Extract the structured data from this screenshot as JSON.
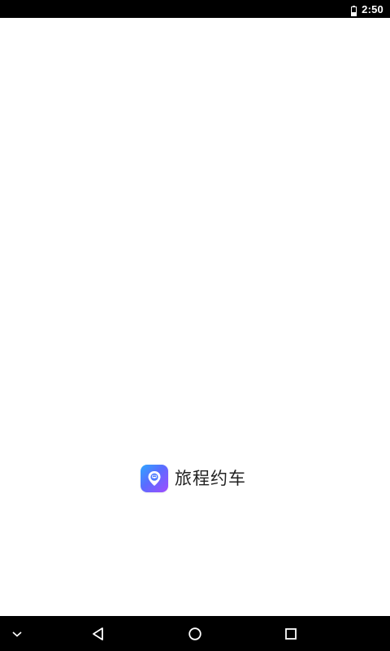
{
  "status_bar": {
    "time": "2:50",
    "icons": [
      "battery-icon"
    ]
  },
  "splash": {
    "app_name": "旅程约车",
    "logo_icon": "car-pin-logo-icon",
    "logo_colors": [
      "#2ea8ff",
      "#5a6cff",
      "#a14cff"
    ]
  },
  "nav_bar": {
    "buttons": [
      "collapse-chevron-icon",
      "back-icon",
      "home-icon",
      "recents-icon"
    ]
  },
  "colors": {
    "background": "#ffffff",
    "system_bars": "#000000",
    "text": "#222222"
  }
}
